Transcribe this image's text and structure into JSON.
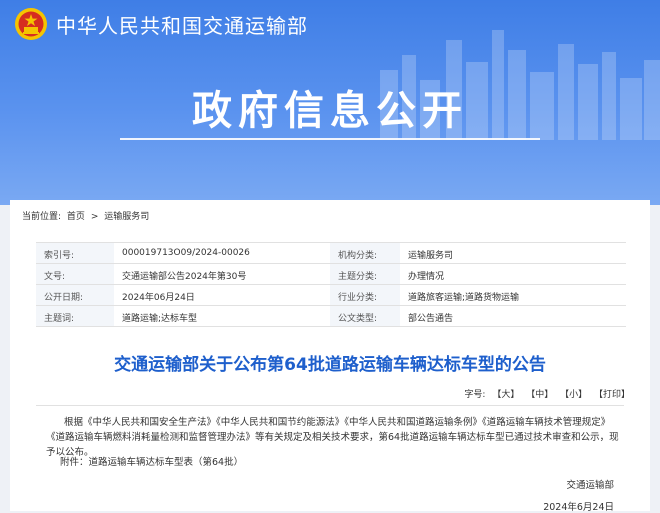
{
  "header": {
    "ministry_name": "中华人民共和国交通运输部",
    "big_title": "政府信息公开"
  },
  "breadcrumb": {
    "label": "当前位置:",
    "home": "首页",
    "separator": ">",
    "current": "运输服务司"
  },
  "meta": {
    "rows": [
      {
        "k1": "索引号:",
        "v1": "000019713O09/2024-00026",
        "k2": "机构分类:",
        "v2": "运输服务司"
      },
      {
        "k1": "文号:",
        "v1": "交通运输部公告2024年第30号",
        "k2": "主题分类:",
        "v2": "办理情况"
      },
      {
        "k1": "公开日期:",
        "v1": "2024年06月24日",
        "k2": "行业分类:",
        "v2": "道路旅客运输;道路货物运输"
      },
      {
        "k1": "主题词:",
        "v1": "道路运输;达标车型",
        "k2": "公文类型:",
        "v2": "部公告通告"
      }
    ]
  },
  "document": {
    "title": "交通运输部关于公布第64批道路运输车辆达标车型的公告",
    "fontsize_label": "字号:",
    "font_large": "【大】",
    "font_medium": "【中】",
    "font_small": "【小】",
    "print": "【打印】",
    "body": "根据《中华人民共和国安全生产法》《中华人民共和国节约能源法》《中华人民共和国道路运输条例》《道路运输车辆技术管理规定》《道路运输车辆燃料消耗量检测和监督管理办法》等有关规定及相关技术要求，第64批道路运输车辆达标车型已通过技术审查和公示，现予以公布。",
    "attachment": "附件：道路运输车辆达标车型表（第64批）",
    "signature_org": "交通运输部",
    "signature_date": "2024年6月24日"
  },
  "colors": {
    "header_blue": "#3f7ee6",
    "title_blue": "#1e5fcc",
    "emblem_red": "#d62d20",
    "emblem_gold": "#f5c400"
  }
}
